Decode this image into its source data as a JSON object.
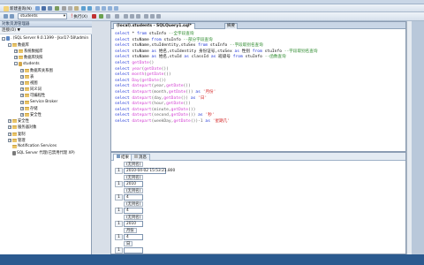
{
  "toolbar1": {
    "new_query_label": "新建查询(N)",
    "database_value": "students"
  },
  "toolbar2": {
    "execute_label": "执行(X)"
  },
  "object_explorer": {
    "title": "对象资源管理器",
    "connect_label": "连接(O) ▼",
    "tree": [
      {
        "label": ". (SQL Server 9.0.1399 - Jkxl17-58\\admin",
        "indent": 0,
        "exp": "-",
        "icon": "server"
      },
      {
        "label": "数据库",
        "indent": 1,
        "exp": "-",
        "icon": "folder"
      },
      {
        "label": "系统数据库",
        "indent": 2,
        "exp": "+",
        "icon": "folder"
      },
      {
        "label": "数据库快照",
        "indent": 2,
        "exp": "+",
        "icon": "folder"
      },
      {
        "label": "students",
        "indent": 2,
        "exp": "-",
        "icon": "db"
      },
      {
        "label": "数据库关系图",
        "indent": 3,
        "exp": "+",
        "icon": "folder"
      },
      {
        "label": "表",
        "indent": 3,
        "exp": "+",
        "icon": "folder"
      },
      {
        "label": "视图",
        "indent": 3,
        "exp": "+",
        "icon": "folder"
      },
      {
        "label": "同义词",
        "indent": 3,
        "exp": "+",
        "icon": "folder"
      },
      {
        "label": "可编程性",
        "indent": 3,
        "exp": "+",
        "icon": "folder"
      },
      {
        "label": "Service Broker",
        "indent": 3,
        "exp": "+",
        "icon": "folder"
      },
      {
        "label": "存储",
        "indent": 3,
        "exp": "+",
        "icon": "folder"
      },
      {
        "label": "安全性",
        "indent": 3,
        "exp": "+",
        "icon": "folder"
      },
      {
        "label": "安全性",
        "indent": 1,
        "exp": "+",
        "icon": "folder"
      },
      {
        "label": "服务器对象",
        "indent": 1,
        "exp": "+",
        "icon": "folder"
      },
      {
        "label": "复制",
        "indent": 1,
        "exp": "+",
        "icon": "folder"
      },
      {
        "label": "管理",
        "indent": 1,
        "exp": "+",
        "icon": "folder"
      },
      {
        "label": "Notification Services",
        "indent": 1,
        "exp": "",
        "icon": "folder"
      },
      {
        "label": "SQL Server 代理(已禁用代理 XP)",
        "indent": 1,
        "exp": "",
        "icon": "agent"
      }
    ]
  },
  "editor": {
    "tab_label": "(local).students - SQLQuery1.sql*",
    "tab_tag": "摘要",
    "lines": [
      [
        {
          "t": "kw",
          "v": "select"
        },
        {
          "t": "",
          "v": " * "
        },
        {
          "t": "kw",
          "v": "from"
        },
        {
          "t": "",
          "v": " stuInfo "
        },
        {
          "t": "cm",
          "v": "--全字段查询"
        }
      ],
      [
        {
          "t": "kw",
          "v": "select"
        },
        {
          "t": "",
          "v": " stuName "
        },
        {
          "t": "kw",
          "v": "from"
        },
        {
          "t": "",
          "v": " stuInfo "
        },
        {
          "t": "cm",
          "v": "--部分字段查询"
        }
      ],
      [
        {
          "t": "kw",
          "v": "select"
        },
        {
          "t": "",
          "v": " stuName,stuIdentity,stuSex "
        },
        {
          "t": "kw",
          "v": "from"
        },
        {
          "t": "",
          "v": " stuInfo "
        },
        {
          "t": "cm",
          "v": "--字段取别名查询"
        }
      ],
      [
        {
          "t": "kw",
          "v": "select"
        },
        {
          "t": "",
          "v": " stuName "
        },
        {
          "t": "kw",
          "v": "as"
        },
        {
          "t": "",
          "v": " 姓名,stuIdentity 身份证号,stuSex "
        },
        {
          "t": "kw",
          "v": "as"
        },
        {
          "t": "",
          "v": " 性别 "
        },
        {
          "t": "kw",
          "v": "from"
        },
        {
          "t": "",
          "v": " stuInfo "
        },
        {
          "t": "cm",
          "v": "--字段取别名查询"
        }
      ],
      [
        {
          "t": "kw",
          "v": "select"
        },
        {
          "t": "",
          "v": " stuName "
        },
        {
          "t": "kw",
          "v": "as"
        },
        {
          "t": "",
          "v": " 姓名,stuId "
        },
        {
          "t": "kw",
          "v": "as"
        },
        {
          "t": "",
          "v": " classId "
        },
        {
          "t": "kw",
          "v": "as"
        },
        {
          "t": "",
          "v": " 班级号 "
        },
        {
          "t": "kw",
          "v": "from"
        },
        {
          "t": "",
          "v": " stuInfo "
        },
        {
          "t": "cm",
          "v": "--函数查询"
        }
      ],
      [
        {
          "t": "kw",
          "v": "select"
        },
        {
          "t": "",
          "v": " "
        },
        {
          "t": "fn",
          "v": "getDate"
        },
        {
          "t": "gr",
          "v": "()"
        }
      ],
      [
        {
          "t": "kw",
          "v": "select"
        },
        {
          "t": "",
          "v": " "
        },
        {
          "t": "fn",
          "v": "year"
        },
        {
          "t": "gr",
          "v": "("
        },
        {
          "t": "fn",
          "v": "getDate"
        },
        {
          "t": "gr",
          "v": "())"
        }
      ],
      [
        {
          "t": "kw",
          "v": "select"
        },
        {
          "t": "",
          "v": " "
        },
        {
          "t": "fn",
          "v": "month"
        },
        {
          "t": "gr",
          "v": "("
        },
        {
          "t": "fn",
          "v": "getDate"
        },
        {
          "t": "gr",
          "v": "())"
        }
      ],
      [
        {
          "t": "kw",
          "v": "select"
        },
        {
          "t": "",
          "v": " "
        },
        {
          "t": "fn",
          "v": "Day"
        },
        {
          "t": "gr",
          "v": "("
        },
        {
          "t": "fn",
          "v": "getDate"
        },
        {
          "t": "gr",
          "v": "())"
        }
      ],
      [
        {
          "t": "kw",
          "v": "select"
        },
        {
          "t": "",
          "v": " "
        },
        {
          "t": "fn",
          "v": "datepart"
        },
        {
          "t": "gr",
          "v": "(year,"
        },
        {
          "t": "fn",
          "v": "getDate"
        },
        {
          "t": "gr",
          "v": "())"
        }
      ],
      [
        {
          "t": "kw",
          "v": "select"
        },
        {
          "t": "",
          "v": " "
        },
        {
          "t": "fn",
          "v": "datepart"
        },
        {
          "t": "gr",
          "v": "(month,"
        },
        {
          "t": "fn",
          "v": "getDate"
        },
        {
          "t": "gr",
          "v": "()) "
        },
        {
          "t": "kw",
          "v": "as"
        },
        {
          "t": "",
          "v": " "
        },
        {
          "t": "str",
          "v": "'月份'"
        }
      ],
      [
        {
          "t": "kw",
          "v": "select"
        },
        {
          "t": "",
          "v": " "
        },
        {
          "t": "fn",
          "v": "datepart"
        },
        {
          "t": "gr",
          "v": "(day,"
        },
        {
          "t": "fn",
          "v": "getDate"
        },
        {
          "t": "gr",
          "v": "()) "
        },
        {
          "t": "kw",
          "v": "as"
        },
        {
          "t": "",
          "v": " "
        },
        {
          "t": "str",
          "v": "'日'"
        }
      ],
      [
        {
          "t": "kw",
          "v": "select"
        },
        {
          "t": "",
          "v": " "
        },
        {
          "t": "fn",
          "v": "datepart"
        },
        {
          "t": "gr",
          "v": "(hour,"
        },
        {
          "t": "fn",
          "v": "getDate"
        },
        {
          "t": "gr",
          "v": "())"
        }
      ],
      [
        {
          "t": "kw",
          "v": "select"
        },
        {
          "t": "",
          "v": " "
        },
        {
          "t": "fn",
          "v": "datepart"
        },
        {
          "t": "gr",
          "v": "(minute,"
        },
        {
          "t": "fn",
          "v": "getDate"
        },
        {
          "t": "gr",
          "v": "())"
        }
      ],
      [
        {
          "t": "kw",
          "v": "select"
        },
        {
          "t": "",
          "v": " "
        },
        {
          "t": "fn",
          "v": "datepart"
        },
        {
          "t": "gr",
          "v": "(second,"
        },
        {
          "t": "fn",
          "v": "getDate"
        },
        {
          "t": "gr",
          "v": "()) "
        },
        {
          "t": "kw",
          "v": "as"
        },
        {
          "t": "",
          "v": " "
        },
        {
          "t": "str",
          "v": "'秒'"
        }
      ],
      [
        {
          "t": "kw",
          "v": "select"
        },
        {
          "t": "",
          "v": " "
        },
        {
          "t": "fn",
          "v": "datepart"
        },
        {
          "t": "gr",
          "v": "(weekDay,"
        },
        {
          "t": "fn",
          "v": "getDate"
        },
        {
          "t": "gr",
          "v": "())-1 "
        },
        {
          "t": "kw",
          "v": "as"
        },
        {
          "t": "",
          "v": " "
        },
        {
          "t": "str",
          "v": "'星期几'"
        }
      ]
    ]
  },
  "results": {
    "tab_results": "结果",
    "tab_messages": "消息",
    "grids": [
      {
        "header": "(无列名)",
        "row": "1",
        "value": "2010-04-02 15:53:21.800"
      },
      {
        "header": "(无列名)",
        "row": "1",
        "value": "2010"
      },
      {
        "header": "(无列名)",
        "row": "1",
        "value": "4"
      },
      {
        "header": "(无列名)",
        "row": "1",
        "value": "4"
      },
      {
        "header": "(无列名)",
        "row": "1",
        "value": "2010"
      },
      {
        "header": "月份",
        "row": "1",
        "value": "4"
      },
      {
        "header": "日",
        "row": "1",
        "value": ""
      }
    ]
  },
  "status": {
    "text": ""
  }
}
